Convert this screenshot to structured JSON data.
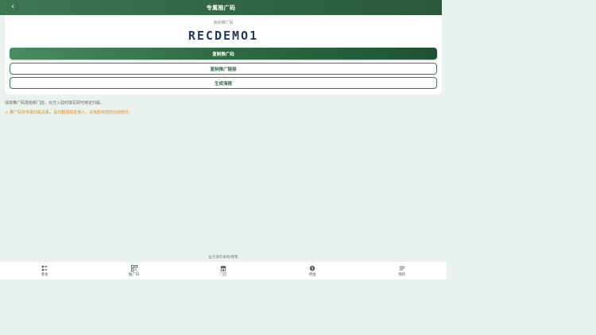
{
  "header": {
    "title": "专属推广码",
    "back_glyph": "‹"
  },
  "card": {
    "code_label": "我的推广码",
    "code": "RECDEMO1",
    "copy_code_label": "复制推广码",
    "copy_link_label": "复制推广链接",
    "poster_label": "生成海报"
  },
  "hint": "请将推广码发给新门店，对方入驻时填写即可绑定归属。",
  "warning": "⚠ 推广码仅专属归属关系，请勿截图转发他人，以免影响您的业绩统计。",
  "footer_note": "益于演示采购/销售",
  "tabs": [
    {
      "label": "看板",
      "icon": "dashboard-icon"
    },
    {
      "label": "推广码",
      "icon": "qrcode-icon",
      "active": true
    },
    {
      "label": "门店",
      "icon": "store-icon"
    },
    {
      "label": "佣金",
      "icon": "commission-icon"
    },
    {
      "label": "我的",
      "icon": "menu-icon"
    }
  ],
  "colors": {
    "primary": "#2f6a45",
    "warning": "#e0892e",
    "background": "#e9f2ec",
    "code": "#1e3a5f"
  }
}
